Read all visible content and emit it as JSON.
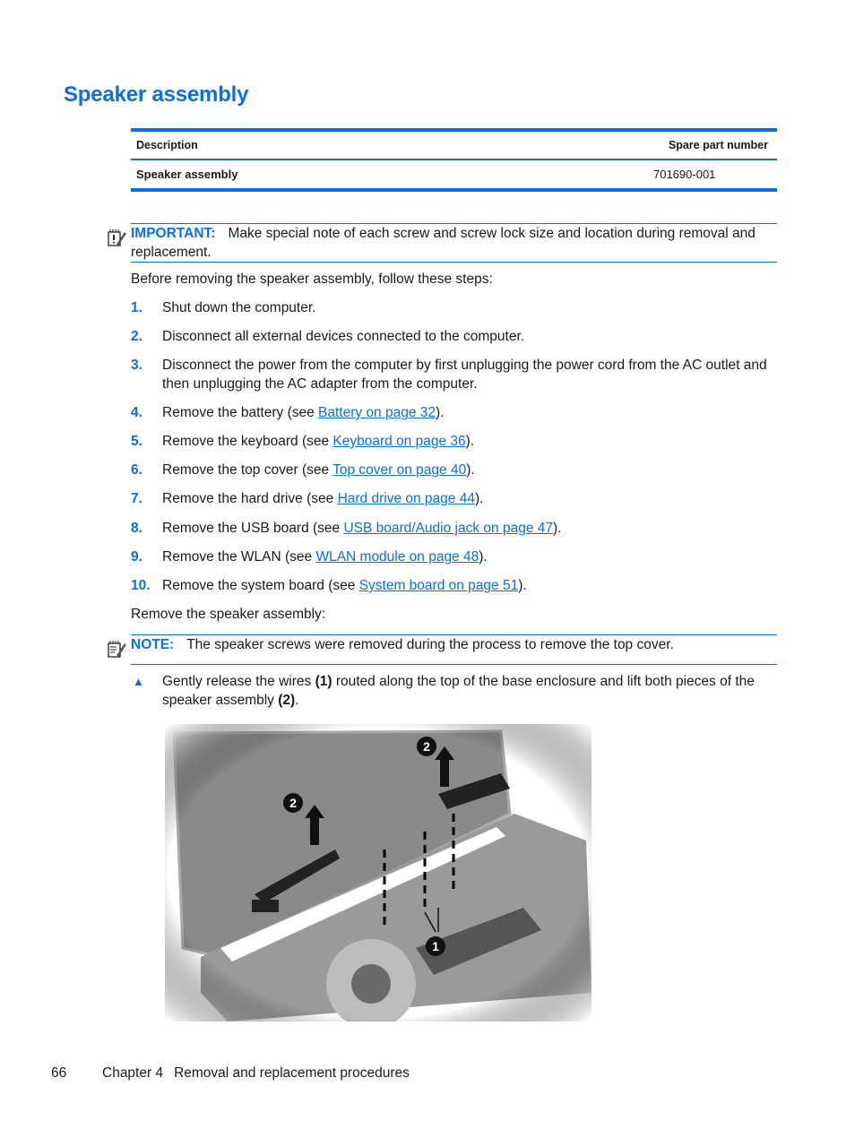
{
  "section_title": "Speaker assembly",
  "spec_table": {
    "headers": [
      "Description",
      "Spare part number"
    ],
    "rows": [
      {
        "description": "Speaker assembly",
        "spare_part_number": "701690-001"
      }
    ]
  },
  "important_note": {
    "label": "IMPORTANT:",
    "text": "Make special note of each screw and screw lock size and location during removal and replacement."
  },
  "intro": "Before removing the speaker assembly, follow these steps:",
  "steps": [
    {
      "num": "1.",
      "text": "Shut down the computer."
    },
    {
      "num": "2.",
      "text": "Disconnect all external devices connected to the computer."
    },
    {
      "num": "3.",
      "text": "Disconnect the power from the computer by first unplugging the power cord from the AC outlet and then unplugging the AC adapter from the computer."
    },
    {
      "num": "4.",
      "pre": "Remove the battery (see ",
      "link": "Battery on page 32",
      "post": ")."
    },
    {
      "num": "5.",
      "pre": "Remove the keyboard (see ",
      "link": "Keyboard on page 36",
      "post": ")."
    },
    {
      "num": "6.",
      "pre": "Remove the top cover (see ",
      "link": "Top cover on page 40",
      "post": ")."
    },
    {
      "num": "7.",
      "pre": "Remove the hard drive (see ",
      "link": "Hard drive on page 44",
      "post": ")."
    },
    {
      "num": "8.",
      "pre": "Remove the USB board (see ",
      "link": "USB board/Audio jack on page 47",
      "post": ")."
    },
    {
      "num": "9.",
      "pre": "Remove the WLAN (see ",
      "link": "WLAN module on page 48",
      "post": ")."
    },
    {
      "num": "10.",
      "pre": "Remove the system board (see ",
      "link": "System board on page 51",
      "post": ")."
    }
  ],
  "remove_heading": "Remove the speaker assembly:",
  "note": {
    "label": "NOTE:",
    "text": "The speaker screws were removed during the process to remove the top cover."
  },
  "instruction": {
    "part1": "Gently release the wires ",
    "callout1": "(1)",
    "part2": " routed along the top of the base enclosure and lift both pieces of the speaker assembly ",
    "callout2": "(2)",
    "part3": "."
  },
  "figure": {
    "description": "Laptop base with display open showing speaker assembly removal",
    "callouts": [
      "2",
      "2",
      "1"
    ]
  },
  "footer": {
    "page_number": "66",
    "chapter": "Chapter 4",
    "section": "Removal and replacement procedures"
  }
}
